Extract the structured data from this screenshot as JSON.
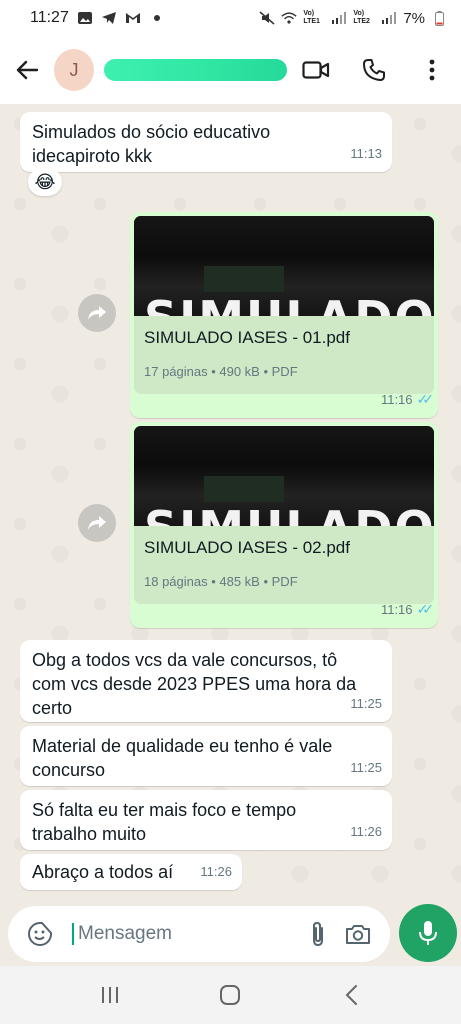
{
  "status_bar": {
    "time": "11:27",
    "battery": "7%",
    "sim1": "Vo) LTE1",
    "sim2": "Vo) LTE2"
  },
  "header": {
    "avatar_letter": "J"
  },
  "messages": [
    {
      "text": "Simulados do sócio educativo idecapiroto kkk",
      "time": "11:13",
      "reaction": "😂"
    },
    {
      "doc_name": "SIMULADO IASES - 01.pdf",
      "doc_meta": "17 páginas • 490 kB • PDF",
      "preview_text": "SIMULADO",
      "time": "11:16"
    },
    {
      "doc_name": "SIMULADO IASES - 02.pdf",
      "doc_meta": "18 páginas • 485 kB • PDF",
      "preview_text": "SIMULADO",
      "time": "11:16"
    },
    {
      "text": "Obg a todos vcs da vale concursos, tô com vcs desde 2023 PPES uma hora da certo",
      "time": "11:25"
    },
    {
      "text": "Material de qualidade eu tenho é vale concurso",
      "time": "11:25"
    },
    {
      "text": "Só falta eu ter mais foco e tempo trabalho muito",
      "time": "11:26"
    },
    {
      "text": "Abraço a todos aí",
      "time": "11:26"
    }
  ],
  "composer": {
    "placeholder": "Mensagem"
  },
  "colors": {
    "accent": "#21a366",
    "outgoing_bubble": "#d9fdd3",
    "read_ticks": "#53bdeb"
  }
}
